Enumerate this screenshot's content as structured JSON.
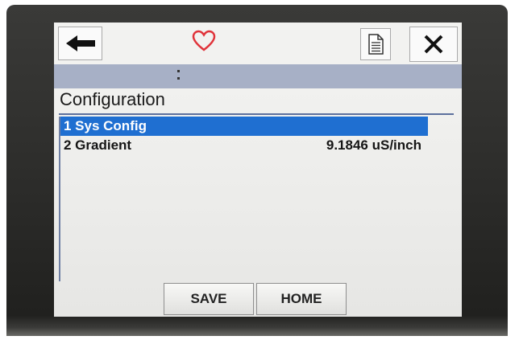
{
  "header": {
    "back_icon": "arrow-left-icon",
    "favorite_icon": "heart-icon",
    "document_icon": "document-icon",
    "close_icon": "close-icon",
    "heart_color": "#e0333a"
  },
  "status": {
    "indicator_icon": "dots-indicator-icon",
    "bar_color": "#a7b0c6"
  },
  "page": {
    "title": "Configuration"
  },
  "menu": {
    "selected_color": "#1f6fd1",
    "items": [
      {
        "label": "1 Sys Config",
        "value": ""
      },
      {
        "label": "2 Gradient",
        "value": "9.1846 uS/inch"
      }
    ]
  },
  "footer": {
    "save_label": "SAVE",
    "home_label": "HOME"
  }
}
